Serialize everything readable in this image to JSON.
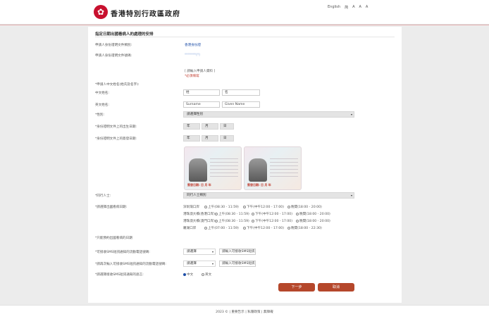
{
  "header": {
    "logo_glyph": "✿",
    "title": "香港特別行政區政府",
    "nav": [
      "English",
      "简",
      "A",
      "A",
      "A"
    ]
  },
  "form": {
    "title": "指定日期出國看病人的處理的安排",
    "applicant_doc_label": "申請人身份證明文件類別:",
    "applicant_doc_value": "香港身份證",
    "applicant_docno_label": "申請人身份證明文件號碼:",
    "applicant_docno_value": "*******(*)",
    "note_line1": "[ 請輸入申請人資料 ]",
    "note_line2": "*必須填寫",
    "patient_name_label": "*申請人中文姓名(姓氏及名字):",
    "chinese_name_label": "中文姓名:",
    "chinese_surname_placeholder": "姓",
    "chinese_given_placeholder": "名",
    "english_name_label": "英文姓名:",
    "english_surname_placeholder": "Surname",
    "english_given_placeholder": "Given Name",
    "sex_label": "*性別:",
    "sex_value": "請選擇性別",
    "dob_label": "*身份證明文件上的出生日期:",
    "dob_parts": [
      "年",
      "月",
      "日"
    ],
    "issue_label": "*身份證明文件上的簽發日期:",
    "issue_parts": [
      "年",
      "月",
      "日"
    ],
    "card_caption": "簽發日期: 日 月 年",
    "role_label": "*同行人士:",
    "role_value": "同行人士類別",
    "slot_label": "*請選擇出國看病日期:",
    "slots": [
      {
        "name": "深圳灣口岸",
        "options": [
          "上午(08:30 - 11:59)",
          "下午(中午12:00 - 17:00)",
          "晚間(18:00 - 20:00)"
        ]
      },
      {
        "name": "港珠澳大橋(香港口岸)",
        "options": [
          "上午(08:30 - 11:59)",
          "下午(中午12:00 - 17:00)",
          "晚間(18:00 - 20:00)"
        ]
      },
      {
        "name": "港珠澳大橋(澳門口岸)",
        "options": [
          "上午(08:30 - 11:59)",
          "下午(中午12:00 - 17:00)",
          "晚間(18:00 - 20:00)"
        ]
      },
      {
        "name": "羅湖口岸",
        "options": [
          "上午(07:00 - 11:59)",
          "下午(中午12:00 - 17:00)",
          "晚間(18:00 - 22:30)"
        ]
      }
    ],
    "slot_note": "*只能預約出國看病的日期",
    "sms_label1": "*可接收SMS短訊通知的流動電話號碼:",
    "sms_label2": "*請再次輸入可接收SMS短訊通知的流動電話號碼:",
    "sms_select": "請選擇",
    "sms_placeholder": "請輸入可接收SMS短訊",
    "lang_label": "*請選擇接收SMS短訊通知的語言:",
    "lang_options": [
      "中文",
      "英文"
    ],
    "next_button": "下一步",
    "cancel_button": "取消"
  },
  "footer": {
    "links": "2023 ©  |  重要告示  |  私隱政策  |  無障礙"
  }
}
